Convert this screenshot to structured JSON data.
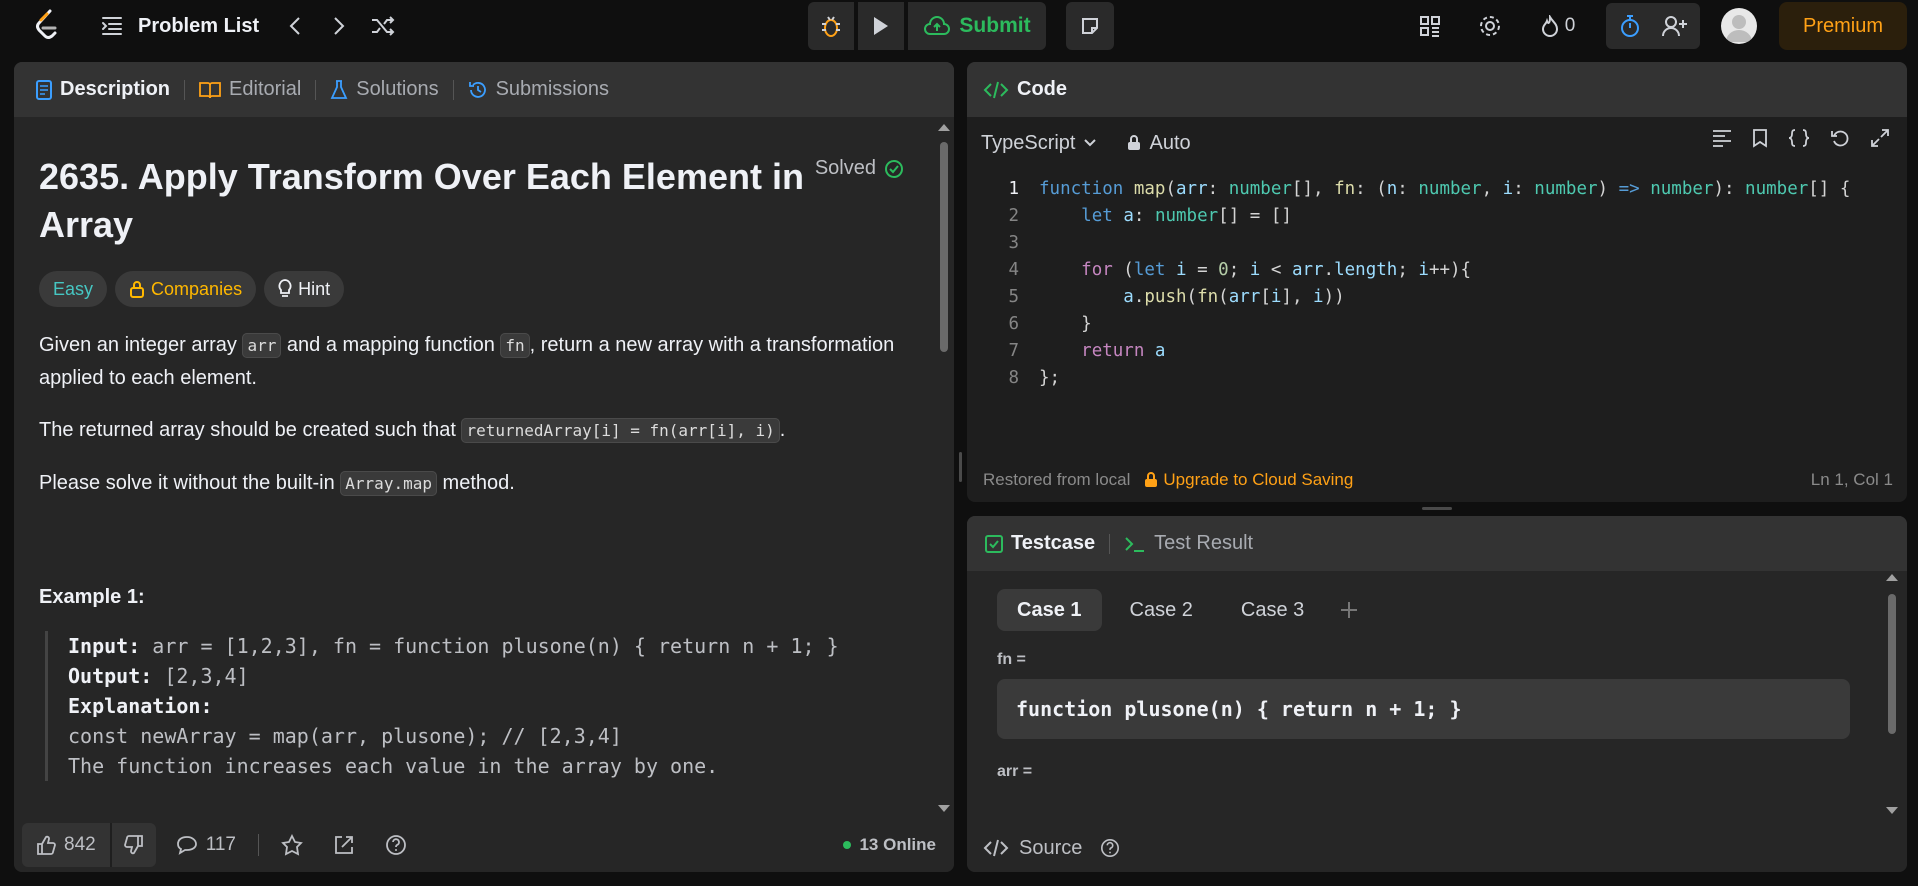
{
  "topbar": {
    "problem_list": "Problem List",
    "submit": "Submit",
    "streak": "0",
    "premium": "Premium"
  },
  "left": {
    "tabs": [
      "Description",
      "Editorial",
      "Solutions",
      "Submissions"
    ],
    "title": "2635. Apply Transform Over Each Element in Array",
    "solved": "Solved",
    "badges": {
      "easy": "Easy",
      "companies": "Companies",
      "hint": "Hint"
    },
    "p1_a": "Given an integer array ",
    "p1_code1": "arr",
    "p1_b": " and a mapping function ",
    "p1_code2": "fn",
    "p1_c": ", return a new array with a transformation applied to each element.",
    "p2_a": "The returned array should be created such that ",
    "p2_code": "returnedArray[i] = fn(arr[i], i)",
    "p2_b": ".",
    "p3_a": "Please solve it without the built-in ",
    "p3_code": "Array.map",
    "p3_b": " method.",
    "example_title": "Example 1:",
    "example": {
      "input_label": "Input:",
      "input": " arr = [1,2,3], fn = function plusone(n) { return n + 1; }",
      "output_label": "Output:",
      "output": " [2,3,4]",
      "explanation_label": "Explanation:",
      "line1": "const newArray = map(arr, plusone); // [2,3,4]",
      "line2": "The function increases each value in the array by one."
    },
    "footer": {
      "likes": "842",
      "comments": "117",
      "online": "13 Online"
    }
  },
  "code": {
    "header": "Code",
    "language": "TypeScript",
    "auto": "Auto",
    "line_numbers": [
      "1",
      "2",
      "3",
      "4",
      "5",
      "6",
      "7",
      "8"
    ],
    "footer_restored": "Restored from local",
    "footer_upgrade": "Upgrade to Cloud Saving",
    "footer_position": "Ln 1, Col 1"
  },
  "testcase": {
    "tab_testcase": "Testcase",
    "tab_result": "Test Result",
    "cases": [
      "Case 1",
      "Case 2",
      "Case 3"
    ],
    "fn_label": "fn =",
    "fn_value": "function plusone(n) { return n + 1; }",
    "arr_label": "arr =",
    "source": "Source"
  }
}
